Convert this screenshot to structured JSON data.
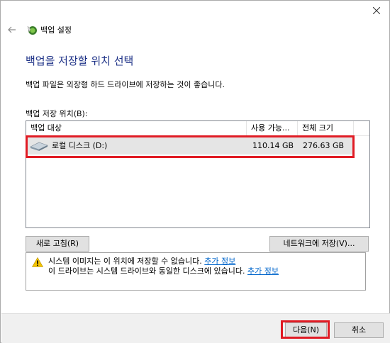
{
  "window": {
    "title": "백업 설정"
  },
  "page": {
    "heading": "백업을 저장할 위치 선택",
    "description": "백업 파일은 외장형 하드 드라이브에 저장하는 것이 좋습니다.",
    "location_label": "백업 저장 위치(B):"
  },
  "table": {
    "columns": [
      "백업 대상",
      "사용 가능...",
      "전체 크기"
    ],
    "rows": [
      {
        "target": "로컬 디스크 (D:)",
        "available": "110.14 GB",
        "total": "276.63 GB",
        "icon": "drive-icon",
        "selected": true
      }
    ]
  },
  "buttons": {
    "refresh": "새로 고침(R)",
    "network": "네트워크에 저장(V)...",
    "next": "다음(N)",
    "cancel": "취소"
  },
  "warning": {
    "icon": "warning-icon",
    "line1": "시스템 이미지는 이 위치에 저장할 수 없습니다.",
    "line1_link": "추가 정보",
    "line2": "이 드라이브는 시스템 드라이브와 동일한 디스크에 있습니다.",
    "line2_link": "추가 정보"
  },
  "colors": {
    "heading": "#1e3287",
    "highlight": "#e01b24",
    "link": "#0066cc",
    "selected_row": "#e5e5e5"
  }
}
